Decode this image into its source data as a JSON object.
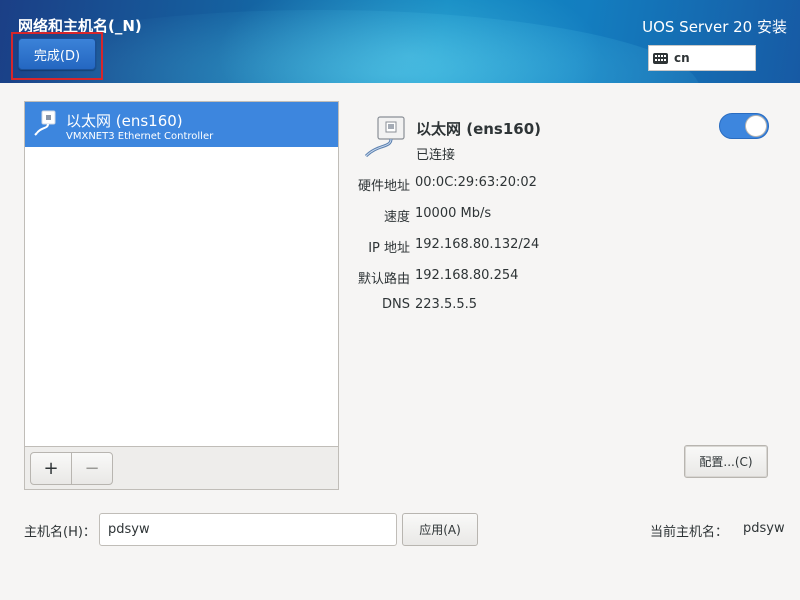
{
  "header": {
    "page_title": "网络和主机名(_N)",
    "done_label": "完成(D)",
    "product_title": "UOS Server 20 安装",
    "keyboard_layout": "cn",
    "accent_color": "#3d86de",
    "highlight_color": "#d6262b"
  },
  "devices": {
    "items": [
      {
        "name": "以太网 (ens160)",
        "description": "VMXNET3 Ethernet Controller",
        "icon": "ethernet-cable-icon",
        "selected": true
      }
    ],
    "add_label": "+",
    "remove_label": "−"
  },
  "detail": {
    "name": "以太网 (ens160)",
    "status": "已连接",
    "enabled": true,
    "icon": "ethernet-cable-icon",
    "properties": [
      {
        "label": "硬件地址",
        "value": "00:0C:29:63:20:02"
      },
      {
        "label": "速度",
        "value": "10000 Mb/s"
      },
      {
        "label": "IP 地址",
        "value": "192.168.80.132/24"
      },
      {
        "label": "默认路由",
        "value": "192.168.80.254"
      },
      {
        "label": "DNS",
        "value": "223.5.5.5"
      }
    ],
    "configure_label": "配置...(C)"
  },
  "hostname": {
    "label": "主机名(H)：",
    "value": "pdsyw",
    "apply_label": "应用(A)",
    "current_label": "当前主机名：",
    "current_value": "pdsyw"
  }
}
